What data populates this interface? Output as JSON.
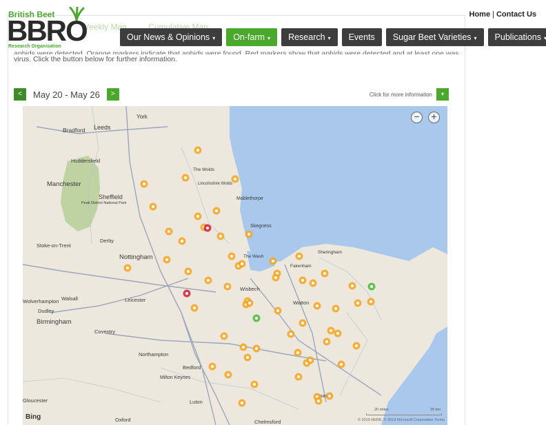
{
  "brand": {
    "top": "British Beet",
    "big": "BBRO",
    "sub": "Research Organisation"
  },
  "top_links": {
    "home": "Home",
    "separator": "|",
    "contact": "Contact Us"
  },
  "nav": [
    {
      "label": "Our News & Opinions",
      "caret": "▾",
      "active": false
    },
    {
      "label": "On-farm",
      "caret": "▾",
      "active": true
    },
    {
      "label": "Research",
      "caret": "▾",
      "active": false
    },
    {
      "label": "Events",
      "caret": "",
      "active": false
    },
    {
      "label": "Sugar Beet Varieties",
      "caret": "▾",
      "active": false
    },
    {
      "label": "Publications",
      "caret": "▾",
      "active": false
    }
  ],
  "faded_tabs": [
    "Weekly Map",
    "Cumulative Map"
  ],
  "intro": {
    "line_clipped": "aphids were detected. Orange markers indicate that aphids were found. Red markers show that aphids were detected and at least one was carrying",
    "line_visible": "virus. Click the button below for further information."
  },
  "date_bar": {
    "prev": "<",
    "label": "May 20 - May 26",
    "next": ">"
  },
  "more_info": {
    "label": "Click for more information",
    "button": "▾"
  },
  "map": {
    "zoom_out": "−",
    "zoom_in": "+",
    "attribution": "Bing",
    "copyright": "© 2019 HERE, © 2019 Microsoft Corporation  Terms",
    "scale_miles": "20 miles",
    "scale_km": "25 km",
    "place_labels": [
      "York",
      "Bradford",
      "Leeds",
      "Huddersfield",
      "Manchester",
      "Sheffield",
      "Peak District National Park",
      "The Wolds",
      "Lincolnshire Wolds",
      "Mablethorpe",
      "Skegness",
      "Stoke-on-Trent",
      "Derby",
      "Nottingham",
      "The Wash",
      "Sheringham",
      "Fakenham",
      "Wisbech",
      "Watton",
      "Walsall",
      "Wolverhampton",
      "Dudley",
      "Birmingham",
      "Leicester",
      "Coventry",
      "Northampton",
      "Bedford",
      "Milton Keynes",
      "Luton",
      "Ipswich",
      "Chelmsford",
      "Oxford",
      "Gloucester"
    ],
    "colors": {
      "orange": "#f5a623",
      "red": "#d0213a",
      "green": "#4cbb3a",
      "sea": "#a9c8ec",
      "land": "#ece8dd",
      "park": "#b7cf98"
    }
  }
}
